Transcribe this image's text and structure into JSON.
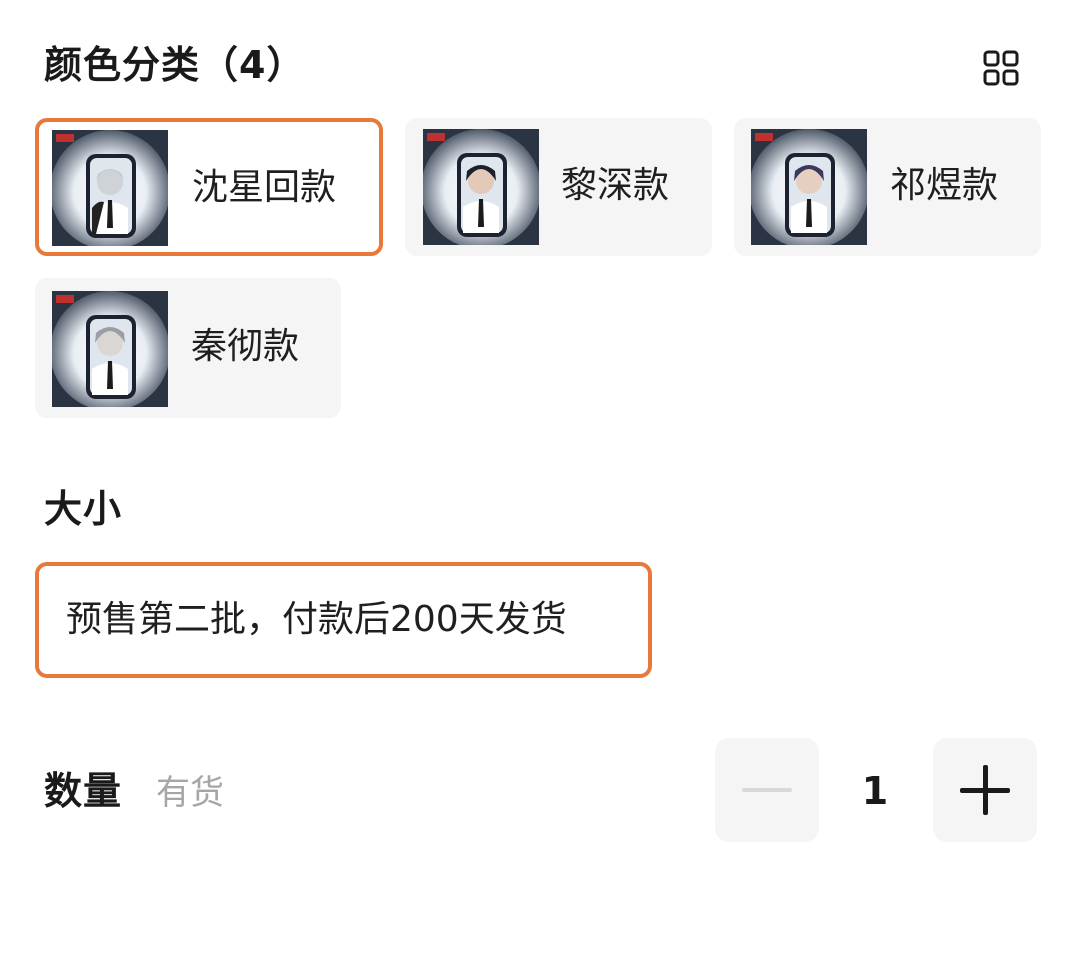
{
  "colors": {
    "accent": "#e8793a",
    "option_bg": "#f5f5f5",
    "muted_text": "#a6a6a6"
  },
  "color_section": {
    "title": "颜色分类（4）",
    "view_toggle_icon": "grid-view-icon",
    "options": [
      {
        "label": "沈星回款",
        "selected": true,
        "thumbnail": "character-photo-card"
      },
      {
        "label": "黎深款",
        "selected": false,
        "thumbnail": "character-photo-card"
      },
      {
        "label": "祁煜款",
        "selected": false,
        "thumbnail": "character-photo-card"
      },
      {
        "label": "秦彻款",
        "selected": false,
        "thumbnail": "character-photo-card"
      }
    ]
  },
  "size_section": {
    "title": "大小",
    "options": [
      {
        "label": "预售第二批，付款后200天发货",
        "selected": true
      }
    ]
  },
  "quantity_section": {
    "title": "数量",
    "stock_status": "有货",
    "value": "1",
    "minus_icon": "minus-icon",
    "plus_icon": "plus-icon"
  }
}
